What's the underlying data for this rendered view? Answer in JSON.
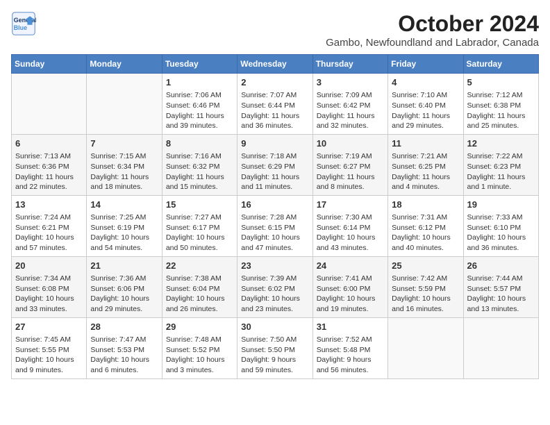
{
  "header": {
    "logo_line1": "General",
    "logo_line2": "Blue",
    "month_title": "October 2024",
    "subtitle": "Gambo, Newfoundland and Labrador, Canada"
  },
  "weekdays": [
    "Sunday",
    "Monday",
    "Tuesday",
    "Wednesday",
    "Thursday",
    "Friday",
    "Saturday"
  ],
  "weeks": [
    [
      {
        "day": "",
        "text": ""
      },
      {
        "day": "",
        "text": ""
      },
      {
        "day": "1",
        "text": "Sunrise: 7:06 AM\nSunset: 6:46 PM\nDaylight: 11 hours and 39 minutes."
      },
      {
        "day": "2",
        "text": "Sunrise: 7:07 AM\nSunset: 6:44 PM\nDaylight: 11 hours and 36 minutes."
      },
      {
        "day": "3",
        "text": "Sunrise: 7:09 AM\nSunset: 6:42 PM\nDaylight: 11 hours and 32 minutes."
      },
      {
        "day": "4",
        "text": "Sunrise: 7:10 AM\nSunset: 6:40 PM\nDaylight: 11 hours and 29 minutes."
      },
      {
        "day": "5",
        "text": "Sunrise: 7:12 AM\nSunset: 6:38 PM\nDaylight: 11 hours and 25 minutes."
      }
    ],
    [
      {
        "day": "6",
        "text": "Sunrise: 7:13 AM\nSunset: 6:36 PM\nDaylight: 11 hours and 22 minutes."
      },
      {
        "day": "7",
        "text": "Sunrise: 7:15 AM\nSunset: 6:34 PM\nDaylight: 11 hours and 18 minutes."
      },
      {
        "day": "8",
        "text": "Sunrise: 7:16 AM\nSunset: 6:32 PM\nDaylight: 11 hours and 15 minutes."
      },
      {
        "day": "9",
        "text": "Sunrise: 7:18 AM\nSunset: 6:29 PM\nDaylight: 11 hours and 11 minutes."
      },
      {
        "day": "10",
        "text": "Sunrise: 7:19 AM\nSunset: 6:27 PM\nDaylight: 11 hours and 8 minutes."
      },
      {
        "day": "11",
        "text": "Sunrise: 7:21 AM\nSunset: 6:25 PM\nDaylight: 11 hours and 4 minutes."
      },
      {
        "day": "12",
        "text": "Sunrise: 7:22 AM\nSunset: 6:23 PM\nDaylight: 11 hours and 1 minute."
      }
    ],
    [
      {
        "day": "13",
        "text": "Sunrise: 7:24 AM\nSunset: 6:21 PM\nDaylight: 10 hours and 57 minutes."
      },
      {
        "day": "14",
        "text": "Sunrise: 7:25 AM\nSunset: 6:19 PM\nDaylight: 10 hours and 54 minutes."
      },
      {
        "day": "15",
        "text": "Sunrise: 7:27 AM\nSunset: 6:17 PM\nDaylight: 10 hours and 50 minutes."
      },
      {
        "day": "16",
        "text": "Sunrise: 7:28 AM\nSunset: 6:15 PM\nDaylight: 10 hours and 47 minutes."
      },
      {
        "day": "17",
        "text": "Sunrise: 7:30 AM\nSunset: 6:14 PM\nDaylight: 10 hours and 43 minutes."
      },
      {
        "day": "18",
        "text": "Sunrise: 7:31 AM\nSunset: 6:12 PM\nDaylight: 10 hours and 40 minutes."
      },
      {
        "day": "19",
        "text": "Sunrise: 7:33 AM\nSunset: 6:10 PM\nDaylight: 10 hours and 36 minutes."
      }
    ],
    [
      {
        "day": "20",
        "text": "Sunrise: 7:34 AM\nSunset: 6:08 PM\nDaylight: 10 hours and 33 minutes."
      },
      {
        "day": "21",
        "text": "Sunrise: 7:36 AM\nSunset: 6:06 PM\nDaylight: 10 hours and 29 minutes."
      },
      {
        "day": "22",
        "text": "Sunrise: 7:38 AM\nSunset: 6:04 PM\nDaylight: 10 hours and 26 minutes."
      },
      {
        "day": "23",
        "text": "Sunrise: 7:39 AM\nSunset: 6:02 PM\nDaylight: 10 hours and 23 minutes."
      },
      {
        "day": "24",
        "text": "Sunrise: 7:41 AM\nSunset: 6:00 PM\nDaylight: 10 hours and 19 minutes."
      },
      {
        "day": "25",
        "text": "Sunrise: 7:42 AM\nSunset: 5:59 PM\nDaylight: 10 hours and 16 minutes."
      },
      {
        "day": "26",
        "text": "Sunrise: 7:44 AM\nSunset: 5:57 PM\nDaylight: 10 hours and 13 minutes."
      }
    ],
    [
      {
        "day": "27",
        "text": "Sunrise: 7:45 AM\nSunset: 5:55 PM\nDaylight: 10 hours and 9 minutes."
      },
      {
        "day": "28",
        "text": "Sunrise: 7:47 AM\nSunset: 5:53 PM\nDaylight: 10 hours and 6 minutes."
      },
      {
        "day": "29",
        "text": "Sunrise: 7:48 AM\nSunset: 5:52 PM\nDaylight: 10 hours and 3 minutes."
      },
      {
        "day": "30",
        "text": "Sunrise: 7:50 AM\nSunset: 5:50 PM\nDaylight: 9 hours and 59 minutes."
      },
      {
        "day": "31",
        "text": "Sunrise: 7:52 AM\nSunset: 5:48 PM\nDaylight: 9 hours and 56 minutes."
      },
      {
        "day": "",
        "text": ""
      },
      {
        "day": "",
        "text": ""
      }
    ]
  ]
}
